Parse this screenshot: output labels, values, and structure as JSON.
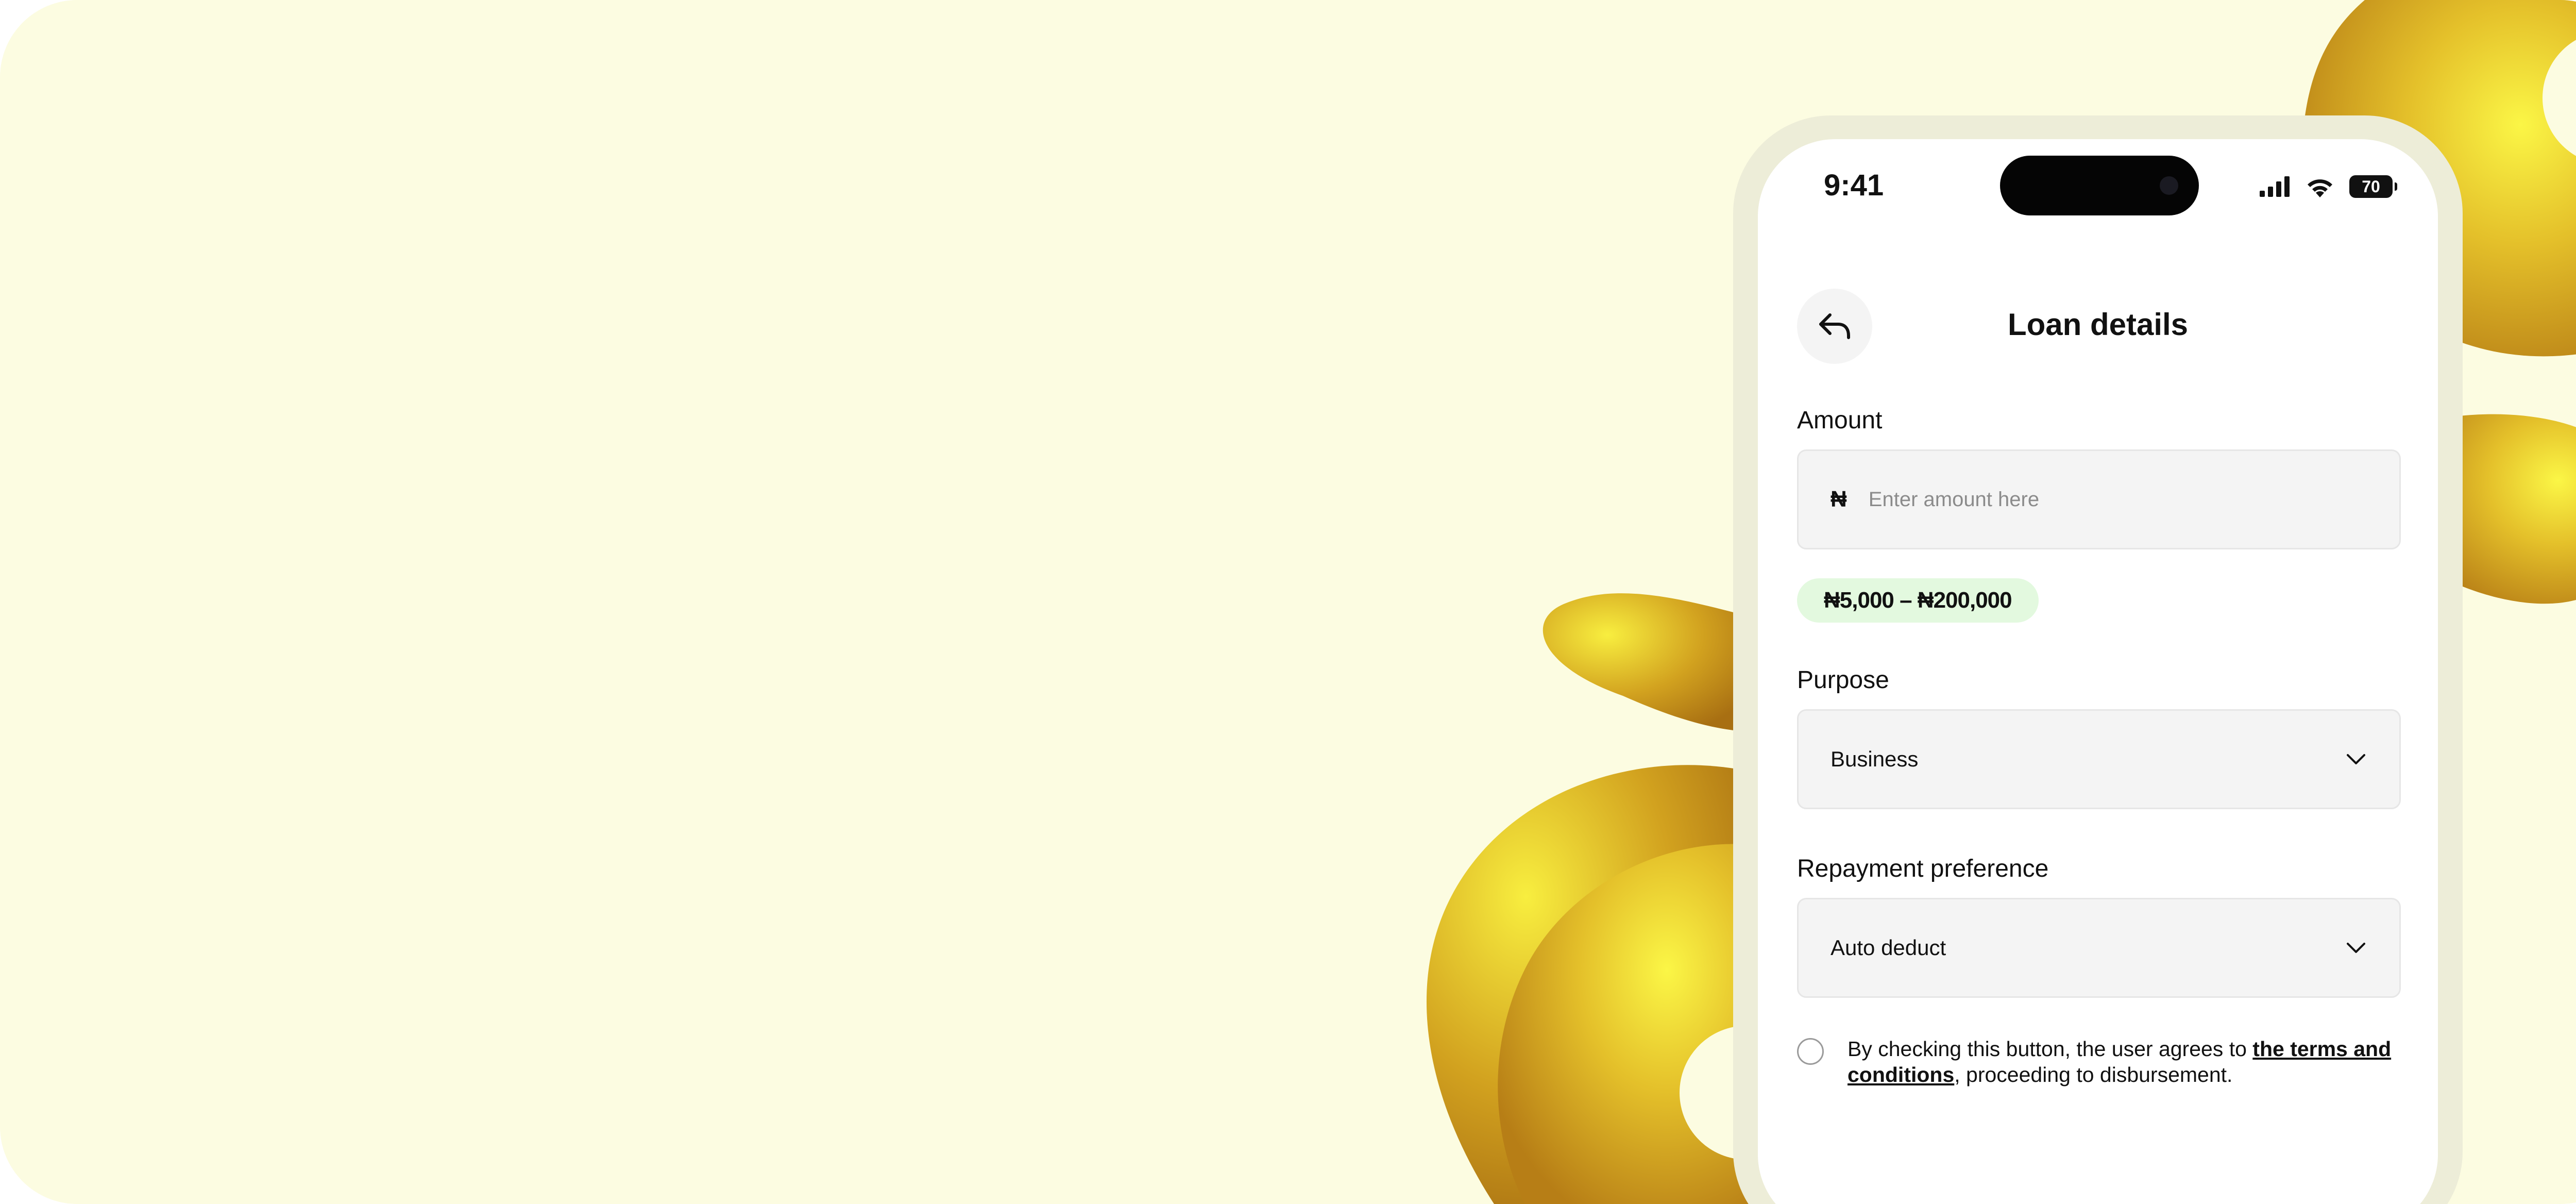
{
  "status_bar": {
    "time": "9:41",
    "battery": "70",
    "icons": [
      "signal-icon",
      "wifi-icon",
      "battery-icon"
    ]
  },
  "header": {
    "title": "Loan details",
    "back_icon": "back-arrow-icon"
  },
  "form": {
    "amount": {
      "label": "Amount",
      "currency_symbol": "₦",
      "value": "",
      "placeholder": "Enter amount here",
      "range_hint": "₦5,000 – ₦200,000"
    },
    "purpose": {
      "label": "Purpose",
      "selected": "Business",
      "icon": "chevron-down-icon"
    },
    "repayment": {
      "label": "Repayment preference",
      "selected": "Auto deduct",
      "icon": "chevron-down-icon"
    },
    "agreement": {
      "checked": false,
      "text_before": "By checking this button, the user agrees to ",
      "link_text": "the terms and conditions",
      "text_after": ", proceeding to disbursement."
    }
  },
  "colors": {
    "background": "#fcfce1",
    "phone_frame": "#ededd8",
    "field_background": "#f4f4f4",
    "range_badge": "#e3f9df",
    "decor_gold": "#c9900f",
    "decor_yellow": "#f6f041"
  }
}
